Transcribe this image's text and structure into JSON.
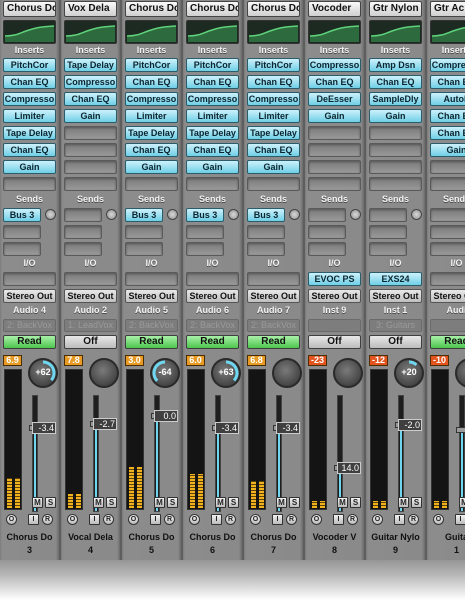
{
  "section_labels": {
    "inserts": "Inserts",
    "sends": "Sends",
    "io": "I/O"
  },
  "strips": [
    {
      "top_name": "Chorus Do",
      "inserts": [
        "PitchCor",
        "Chan EQ",
        "Compresso",
        "Limiter",
        "Tape Delay",
        "Chan EQ",
        "Gain"
      ],
      "sends": [
        "Bus 3"
      ],
      "io_in": "",
      "io_out": "Stereo Out",
      "group": "2: BackVox",
      "track": "Audio 4",
      "automation": "Read",
      "peak": "6.9",
      "peak_level": "warm",
      "pan": "+62",
      "pan_value": 62,
      "volume": "-3.4",
      "fader_level": 0.72,
      "meter_level": 0.22,
      "name": "Chorus Do",
      "number": "3"
    },
    {
      "top_name": "Vox Dela",
      "inserts": [
        "Tape Delay",
        "Compresso",
        "Chan EQ",
        "Gain"
      ],
      "sends": [],
      "io_in": "",
      "io_out": "Stereo Out",
      "group": "1: LeadVox",
      "track": "Audio 2",
      "automation": "Off",
      "peak": "7.8",
      "peak_level": "warm",
      "pan": "",
      "pan_value": 0,
      "volume": "-2.7",
      "fader_level": 0.75,
      "meter_level": 0.1,
      "name": "Vocal Dela",
      "number": "4"
    },
    {
      "top_name": "Chorus Do",
      "inserts": [
        "PitchCor",
        "Chan EQ",
        "Compresso",
        "Limiter",
        "Tape Delay",
        "Chan EQ",
        "Gain"
      ],
      "sends": [
        "Bus 3"
      ],
      "io_in": "",
      "io_out": "Stereo Out",
      "group": "2: BackVox",
      "track": "Audio 5",
      "automation": "Read",
      "peak": "3.0",
      "peak_level": "warm",
      "pan": "-64",
      "pan_value": -64,
      "volume": "0.0",
      "fader_level": 0.82,
      "meter_level": 0.3,
      "name": "Chorus Do",
      "number": "5"
    },
    {
      "top_name": "Chorus Do",
      "inserts": [
        "PitchCor",
        "Chan EQ",
        "Compresso",
        "Limiter",
        "Tape Delay",
        "Chan EQ",
        "Gain"
      ],
      "sends": [
        "Bus 3"
      ],
      "io_in": "",
      "io_out": "Stereo Out",
      "group": "2: BackVox",
      "track": "Audio 6",
      "automation": "Read",
      "peak": "6.0",
      "peak_level": "warm",
      "pan": "+63",
      "pan_value": 63,
      "volume": "-3.4",
      "fader_level": 0.72,
      "meter_level": 0.25,
      "name": "Chorus Do",
      "number": "6"
    },
    {
      "top_name": "Chorus Do",
      "inserts": [
        "PitchCor",
        "Chan EQ",
        "Compresso",
        "Limiter",
        "Tape Delay",
        "Chan EQ",
        "Gain"
      ],
      "sends": [
        "Bus 3"
      ],
      "io_in": "",
      "io_out": "Stereo Out",
      "group": "2: BackVox",
      "track": "Audio 7",
      "automation": "Read",
      "peak": "6.8",
      "peak_level": "warm",
      "pan": "",
      "pan_value": 0,
      "volume": "-3.4",
      "fader_level": 0.72,
      "meter_level": 0.2,
      "name": "Chorus Do",
      "number": "7"
    },
    {
      "top_name": "Vocoder",
      "inserts": [
        "Compresso",
        "Chan EQ",
        "DeEsser",
        "Gain"
      ],
      "sends": [],
      "io_in": "EVOC PS",
      "io_out": "Stereo Out",
      "group": "",
      "track": "Inst 9",
      "automation": "Off",
      "peak": "-23",
      "peak_level": "hot",
      "pan": "",
      "pan_value": 0,
      "volume": "14.0",
      "fader_level": 0.38,
      "meter_level": 0.05,
      "name": "Vocoder V",
      "number": "8"
    },
    {
      "top_name": "Gtr Nylon",
      "inserts": [
        "Amp Dsn",
        "Chan EQ",
        "SampleDly",
        "Gain"
      ],
      "sends": [],
      "io_in": "EXS24",
      "io_out": "Stereo Out",
      "group": "3: Guitars",
      "track": "Inst 1",
      "automation": "Off",
      "peak": "-12",
      "peak_level": "hot",
      "pan": "+20",
      "pan_value": 20,
      "volume": "-2.0",
      "fader_level": 0.74,
      "meter_level": 0.05,
      "name": "Guitar Nylo",
      "number": "9"
    },
    {
      "top_name": "Gtr Ac",
      "inserts": [
        "Compresso",
        "Chan EQ",
        "AutoF",
        "Chan EQ",
        "Chan EQ",
        "Gain"
      ],
      "sends": [],
      "io_in": "",
      "io_out": "Stereo Out",
      "group": "",
      "track": "Audi",
      "automation": "Read",
      "peak": "-10",
      "peak_level": "hot",
      "pan": "",
      "pan_value": 0,
      "volume": "",
      "fader_level": 0.7,
      "meter_level": 0.05,
      "name": "Guita",
      "number": "1"
    }
  ],
  "icons": {
    "mute": "M",
    "solo": "S",
    "input": "I",
    "record": "R",
    "ring": "O"
  },
  "colors": {
    "plugin": "#6fcfe6",
    "read": "#4cc64c",
    "meter": "#f2b21e",
    "pan_ring": "#6fd6f0"
  }
}
